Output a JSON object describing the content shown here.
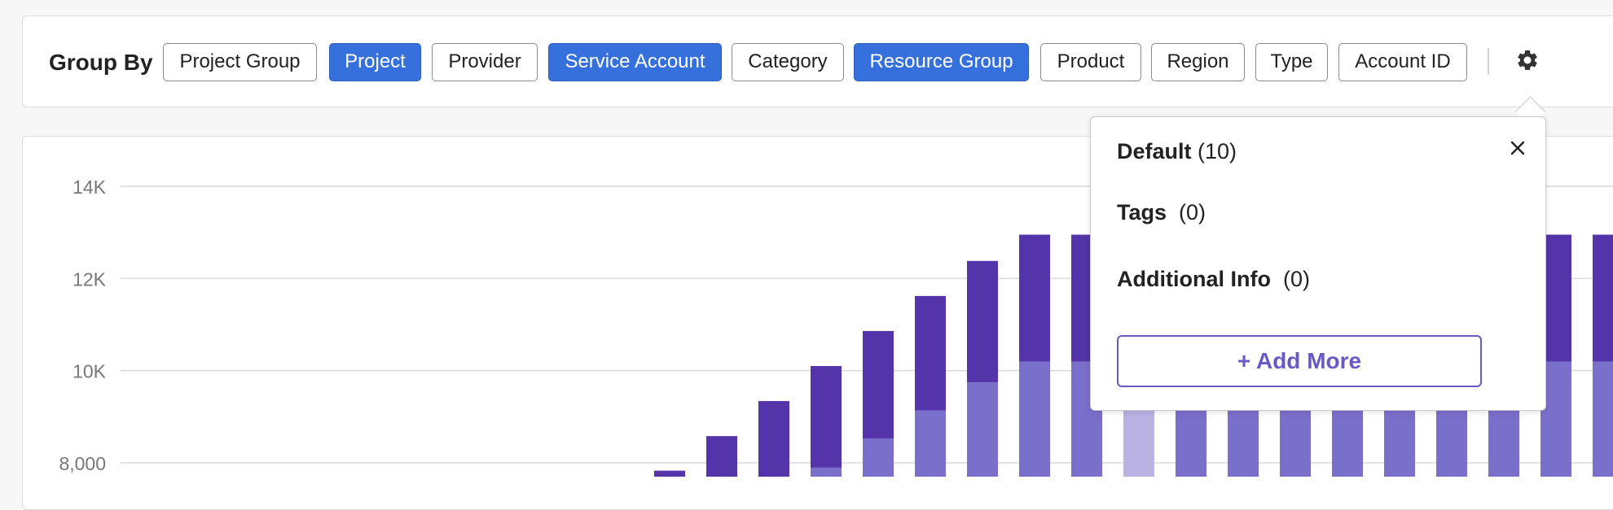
{
  "group_by": {
    "label": "Group By",
    "options": [
      {
        "label": "Project Group",
        "selected": false
      },
      {
        "label": "Project",
        "selected": true
      },
      {
        "label": "Provider",
        "selected": false
      },
      {
        "label": "Service Account",
        "selected": true
      },
      {
        "label": "Category",
        "selected": false
      },
      {
        "label": "Resource Group",
        "selected": true
      },
      {
        "label": "Product",
        "selected": false
      },
      {
        "label": "Region",
        "selected": false
      },
      {
        "label": "Type",
        "selected": false
      },
      {
        "label": "Account ID",
        "selected": false
      }
    ],
    "settings_icon": "gear-icon"
  },
  "popover": {
    "rows": [
      {
        "name": "Default",
        "count": "(10)"
      },
      {
        "name": "Tags",
        "count": "(0)"
      },
      {
        "name": "Additional Info",
        "count": "(0)"
      }
    ],
    "close_icon": "close-icon",
    "add_more_label": "+ Add More"
  },
  "colors": {
    "selected_chip": "#3670dc",
    "series_top": "#5533a8",
    "series_bottom": "#7b6fcc",
    "series_bottom_highlight": "#bbb2e4",
    "accent": "#6c58c4"
  },
  "chart_data": {
    "type": "bar",
    "stacked": true,
    "y_ticks": [
      "14K",
      "12K",
      "10K",
      "8,000"
    ],
    "ylim": [
      8000,
      14000
    ],
    "grid": true,
    "series": [
      {
        "values": [
          7830,
          8580,
          9340,
          10100,
          10860,
          11620,
          12380,
          12950,
          12950,
          12950,
          12950,
          12950,
          12950,
          12950,
          12950,
          12950,
          12950,
          12950,
          12950,
          12950
        ]
      },
      {
        "values": [
          null,
          null,
          null,
          7900,
          8530,
          9140,
          9750,
          10200,
          10200,
          10200,
          10200,
          10200,
          10200,
          10200,
          10200,
          10200,
          10200,
          10200,
          10200,
          10200
        ]
      }
    ],
    "highlighted_index": 9
  }
}
